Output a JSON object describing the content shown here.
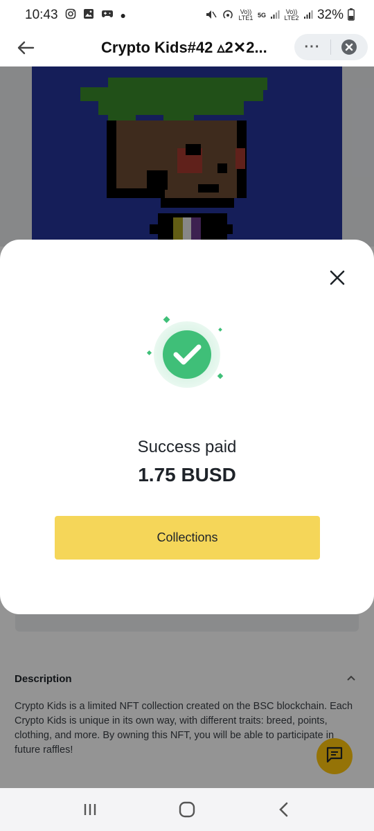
{
  "status_bar": {
    "time": "10:43",
    "battery": "32%",
    "network_labels": [
      "Vo)) LTE1",
      "5G",
      "Vo)) LTE2"
    ],
    "icons": [
      "instagram-icon",
      "gallery-icon",
      "game-icon",
      "dot-icon",
      "mute-icon",
      "hotspot-icon",
      "signal-icon",
      "battery-icon"
    ]
  },
  "header": {
    "title": "Crypto Kids#42 ▵2✕2...",
    "more_label": "···"
  },
  "modal": {
    "success_label": "Success paid",
    "amount": "1.75 BUSD",
    "button_label": "Collections"
  },
  "description": {
    "title": "Description",
    "body": "Crypto Kids is a limited NFT collection created on the BSC blockchain. Each Crypto Kids is unique in its own way, with different traits: breed, points, clothing, and more. By owning this NFT, you will be able to participate in future raffles!"
  },
  "colors": {
    "accent_yellow": "#f5d659",
    "success_green": "#3fbf78",
    "nft_background": "#25349a"
  }
}
